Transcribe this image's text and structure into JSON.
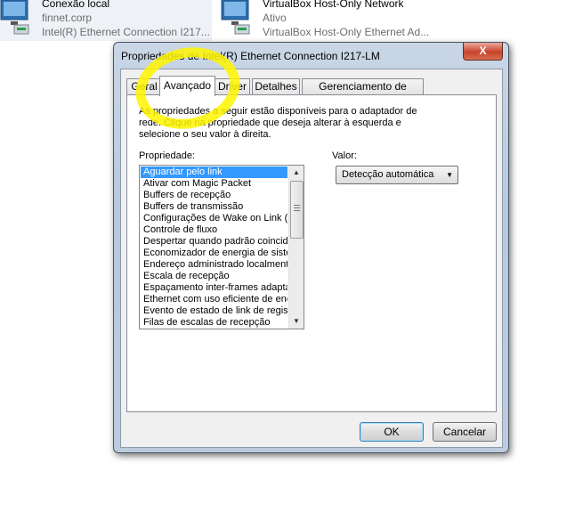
{
  "background": {
    "connections": [
      {
        "name": "Conexão local",
        "status": "finnet.corp",
        "adapter": "Intel(R) Ethernet Connection I217..."
      },
      {
        "name": "VirtualBox Host-Only Network",
        "status": "Ativo",
        "adapter": "VirtualBox Host-Only Ethernet Ad..."
      }
    ]
  },
  "dialog": {
    "title": "Propriedades de Intel(R) Ethernet Connection I217-LM",
    "close_label": "X",
    "tabs": [
      {
        "label": "Geral"
      },
      {
        "label": "Avançado"
      },
      {
        "label": "Driver"
      },
      {
        "label": "Detalhes"
      },
      {
        "label": "Gerenciamento de Energia"
      }
    ],
    "active_tab": "Avançado",
    "description": "As propriedades a seguir estão disponíveis para o adaptador de rede. Clique na propriedade que deseja alterar à esquerda e selecione o seu valor à direita.",
    "property_label": "Propriedade:",
    "value_label": "Valor:",
    "properties": [
      "Aguardar pelo link",
      "Ativar com Magic Packet",
      "Buffers de recepção",
      "Buffers de transmissão",
      "Configurações de Wake on Link (a",
      "Controle de fluxo",
      "Despertar quando padrão coincide",
      "Economizador de energia de sisten",
      "Endereço administrado localmente",
      "Escala de recepção",
      "Espaçamento inter-frames adaptati",
      "Ethernet com uso eficiente de ener",
      "Evento de estado de link de registr",
      "Filas de escalas de recepção"
    ],
    "selected_property": "Aguardar pelo link",
    "value_selected": "Detecção automática",
    "ok_label": "OK",
    "cancel_label": "Cancelar"
  }
}
